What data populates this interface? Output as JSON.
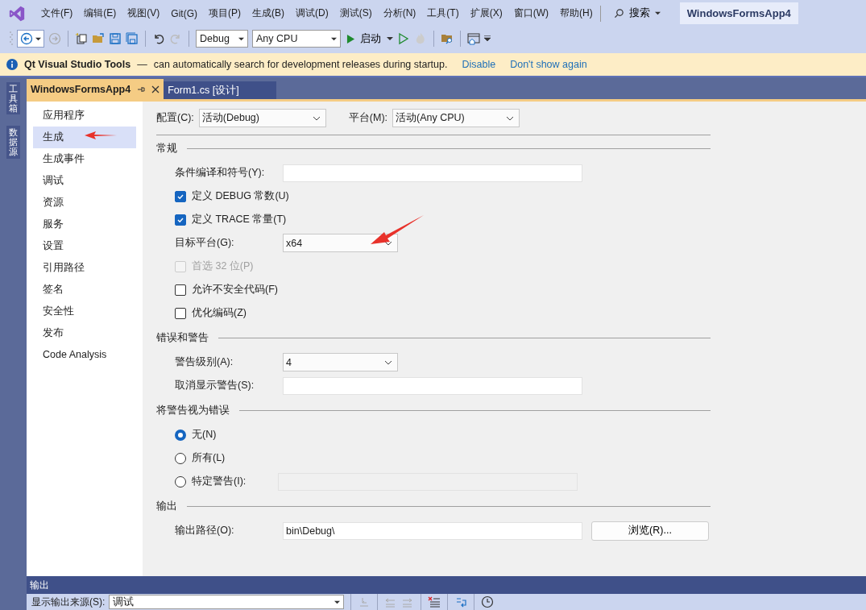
{
  "menu": [
    "文件(F)",
    "编辑(E)",
    "视图(V)",
    "Git(G)",
    "项目(P)",
    "生成(B)",
    "调试(D)",
    "测试(S)",
    "分析(N)",
    "工具(T)",
    "扩展(X)",
    "窗口(W)",
    "帮助(H)"
  ],
  "search": "搜索",
  "solution_title": "WindowsFormsApp4",
  "toolbar": {
    "configuration": "Debug",
    "platform": "Any CPU",
    "start": "启动"
  },
  "infobar": {
    "title": "Qt Visual Studio Tools",
    "dash": "—",
    "message": "can automatically search for development releases during startup.",
    "links": [
      "Disable",
      "Don't show again"
    ]
  },
  "side_tabs": [
    "工具箱",
    "数据源"
  ],
  "tabs": [
    {
      "label": "WindowsFormsApp4",
      "selected": true
    },
    {
      "label": "Form1.cs [设计]",
      "selected": false
    }
  ],
  "nav": [
    {
      "label": "应用程序",
      "selected": false
    },
    {
      "label": "生成",
      "selected": true
    },
    {
      "label": "生成事件",
      "selected": false
    },
    {
      "label": "调试",
      "selected": false
    },
    {
      "label": "资源",
      "selected": false
    },
    {
      "label": "服务",
      "selected": false
    },
    {
      "label": "设置",
      "selected": false
    },
    {
      "label": "引用路径",
      "selected": false
    },
    {
      "label": "签名",
      "selected": false
    },
    {
      "label": "安全性",
      "selected": false
    },
    {
      "label": "发布",
      "selected": false
    },
    {
      "label": "Code Analysis",
      "selected": false
    }
  ],
  "config_row": {
    "config_label": "配置(C):",
    "config_value": "活动(Debug)",
    "platform_label": "平台(M):",
    "platform_value": "活动(Any CPU)"
  },
  "sections": [
    {
      "title": "常规",
      "rows": [
        {
          "kind": "field",
          "label": "条件编译和符号(Y):",
          "disabled": false
        },
        {
          "kind": "checkbox",
          "label": "定义 DEBUG 常数(U)",
          "checked": true,
          "disabled": false
        },
        {
          "kind": "checkbox",
          "label": "定义 TRACE 常量(T)",
          "checked": true,
          "disabled": false
        },
        {
          "kind": "dropdown",
          "label": "目标平台(G):",
          "value": "x64"
        },
        {
          "kind": "checkbox",
          "label": "首选 32 位(P)",
          "checked": false,
          "disabled": true
        },
        {
          "kind": "checkbox",
          "label": "允许不安全代码(F)",
          "checked": false,
          "disabled": false
        },
        {
          "kind": "checkbox",
          "label": "优化编码(Z)",
          "checked": false,
          "disabled": false
        }
      ]
    },
    {
      "title": "错误和警告",
      "rows": [
        {
          "kind": "dropdown",
          "label": "警告级别(A):",
          "value": "4"
        },
        {
          "kind": "field",
          "label": "取消显示警告(S):",
          "disabled": false
        }
      ]
    },
    {
      "title": "将警告视为错误",
      "rows": [
        {
          "kind": "radio",
          "label": "无(N)",
          "selected": true
        },
        {
          "kind": "radio",
          "label": "所有(L)",
          "selected": false
        },
        {
          "kind": "radiofield",
          "label": "特定警告(I):",
          "selected": false,
          "disabled": true
        }
      ]
    },
    {
      "title": "输出",
      "rows": [
        {
          "kind": "path",
          "label": "输出路径(O):",
          "value": "bin\\Debug\\",
          "button": "浏览(R)..."
        }
      ]
    }
  ],
  "output_panel": {
    "title": "输出",
    "source_label": "显示输出来源(S):",
    "source_value": "调试"
  }
}
